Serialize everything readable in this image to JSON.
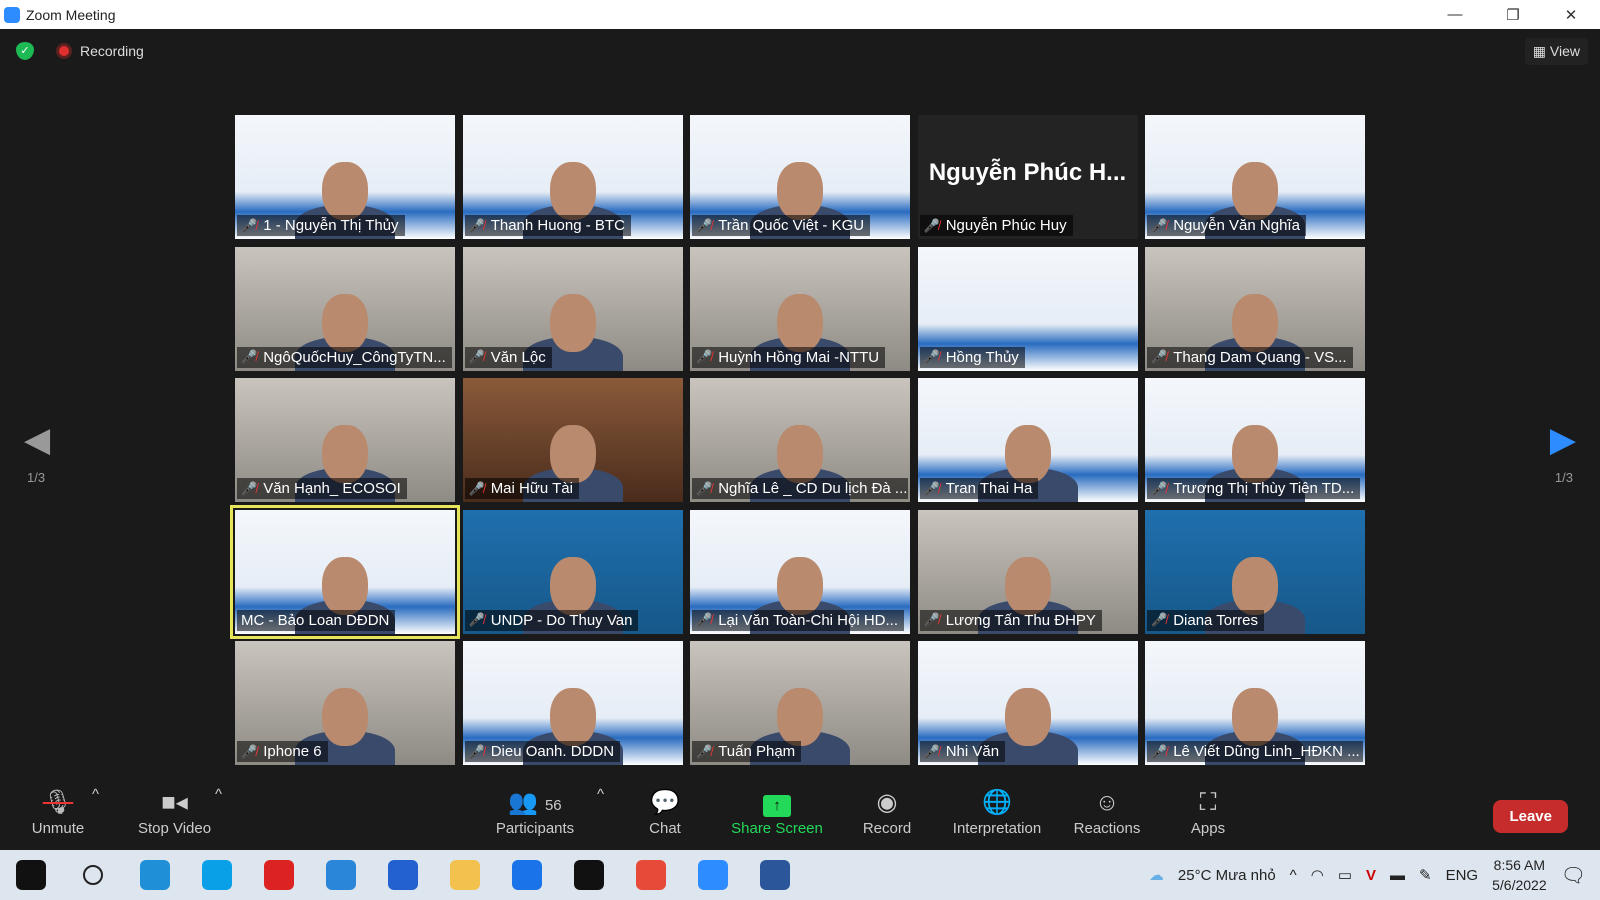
{
  "window": {
    "title": "Zoom Meeting",
    "min": "—",
    "restore": "❐",
    "close": "✕"
  },
  "status": {
    "recording": "Recording",
    "view": "View"
  },
  "pager": {
    "page": "1/3"
  },
  "participants": [
    {
      "name": "1 - Nguyễn Thị Thủy",
      "bg": "slide"
    },
    {
      "name": "Thanh Huong - BTC",
      "bg": "slide"
    },
    {
      "name": "Trần Quốc Việt - KGU",
      "bg": "slide"
    },
    {
      "name": "Nguyễn Phúc Huy",
      "bg": "none",
      "big": "Nguyễn Phúc H..."
    },
    {
      "name": "Nguyễn Văn Nghĩa",
      "bg": "slide"
    },
    {
      "name": "NgôQuốcHuy_CôngTyTN...",
      "bg": "room"
    },
    {
      "name": "Văn Lộc",
      "bg": "room"
    },
    {
      "name": "Huỳnh Hồng Mai -NTTU",
      "bg": "room"
    },
    {
      "name": "Hồng Thủy",
      "bg": "slide",
      "noface": true
    },
    {
      "name": "Thang Dam Quang - VS...",
      "bg": "room"
    },
    {
      "name": "Văn Hạnh_ ECOSOI",
      "bg": "room"
    },
    {
      "name": "Mai Hữu Tài",
      "bg": "wood"
    },
    {
      "name": "Nghĩa Lê _ CD Du lịch Đà ...",
      "bg": "room"
    },
    {
      "name": "Tran Thai Ha",
      "bg": "slide"
    },
    {
      "name": "Trương Thị Thùy Tiên TD...",
      "bg": "slide"
    },
    {
      "name": "MC - Bảo Loan DĐDN",
      "bg": "slide",
      "selected": true,
      "unmuted": true
    },
    {
      "name": "UNDP - Do Thuy Van",
      "bg": "blue"
    },
    {
      "name": "Lại Văn Toàn-Chi Hội HD...",
      "bg": "slide"
    },
    {
      "name": "Lương Tấn Thu ĐHPY",
      "bg": "room"
    },
    {
      "name": "Diana Torres",
      "bg": "blue"
    },
    {
      "name": "Iphone 6",
      "bg": "room"
    },
    {
      "name": "Dieu Oanh. DDDN",
      "bg": "slide"
    },
    {
      "name": "Tuấn Phạm",
      "bg": "room"
    },
    {
      "name": "Nhi Văn",
      "bg": "slide"
    },
    {
      "name": "Lê Viết Dũng Linh_HĐKN ...",
      "bg": "slide"
    }
  ],
  "toolbar": {
    "unmute": "Unmute",
    "stop_video": "Stop Video",
    "participants": "Participants",
    "participant_count": "56",
    "chat": "Chat",
    "share_screen": "Share Screen",
    "record": "Record",
    "interpretation": "Interpretation",
    "reactions": "Reactions",
    "apps": "Apps",
    "leave": "Leave"
  },
  "colors": {
    "share": "#23d959",
    "leave": "#c72c2c",
    "selected": "#e7e65a"
  },
  "taskbar": {
    "apps": [
      "windows-start",
      "search",
      "edge",
      "skype",
      "gift",
      "mail",
      "pdf",
      "file-explorer",
      "zalo",
      "webex",
      "chrome",
      "zoom",
      "word"
    ],
    "weather": "25°C  Mưa nhỏ",
    "lang": "ENG",
    "time": "8:56 AM",
    "date": "5/6/2022"
  }
}
